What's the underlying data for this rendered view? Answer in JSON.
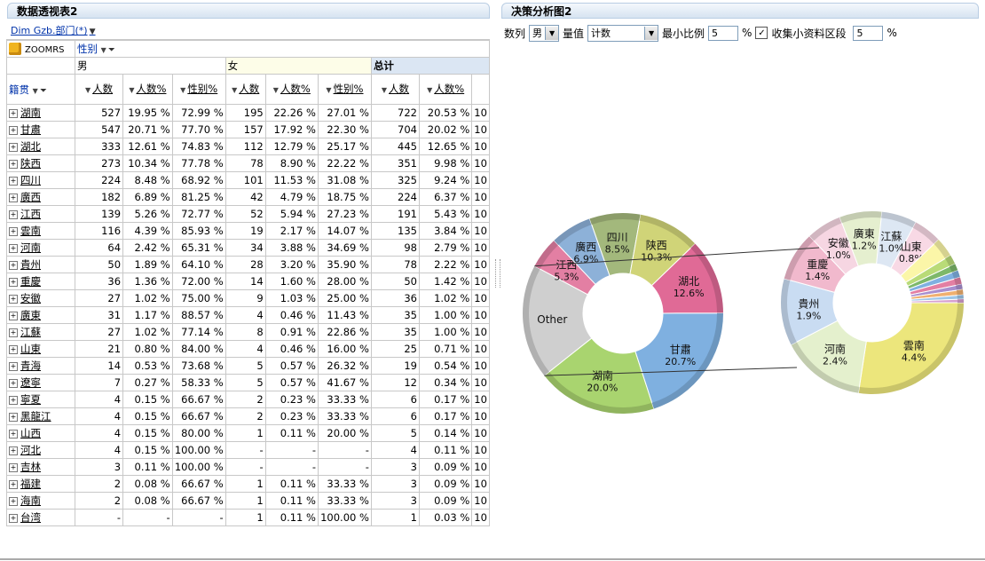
{
  "left_panel": {
    "title": "数据透视表2",
    "dim_link": "Dim Gzb.部门(*)",
    "cube_label": "ZOOMRS",
    "column_field": "性别",
    "row_field": "籍贯",
    "groups": [
      "男",
      "女",
      "总计"
    ],
    "measure_headers": {
      "count": "人数",
      "pct_count": "人数%",
      "pct_sex": "性别%"
    },
    "rows": [
      {
        "name": "湖南",
        "m": [
          "527",
          "19.95 %",
          "72.99 %"
        ],
        "f": [
          "195",
          "22.26 %",
          "27.01 %"
        ],
        "t": [
          "722",
          "20.53 %"
        ],
        "mv": 527,
        "fv": 195,
        "tv": 722
      },
      {
        "name": "甘肅",
        "m": [
          "547",
          "20.71 %",
          "77.70 %"
        ],
        "f": [
          "157",
          "17.92 %",
          "22.30 %"
        ],
        "t": [
          "704",
          "20.02 %"
        ],
        "mv": 547,
        "fv": 157,
        "tv": 704
      },
      {
        "name": "湖北",
        "m": [
          "333",
          "12.61 %",
          "74.83 %"
        ],
        "f": [
          "112",
          "12.79 %",
          "25.17 %"
        ],
        "t": [
          "445",
          "12.65 %"
        ],
        "mv": 333,
        "fv": 112,
        "tv": 445
      },
      {
        "name": "陕西",
        "m": [
          "273",
          "10.34 %",
          "77.78 %"
        ],
        "f": [
          "78",
          "8.90 %",
          "22.22 %"
        ],
        "t": [
          "351",
          "9.98 %"
        ],
        "mv": 273,
        "fv": 78,
        "tv": 351
      },
      {
        "name": "四川",
        "m": [
          "224",
          "8.48 %",
          "68.92 %"
        ],
        "f": [
          "101",
          "11.53 %",
          "31.08 %"
        ],
        "t": [
          "325",
          "9.24 %"
        ],
        "mv": 224,
        "fv": 101,
        "tv": 325
      },
      {
        "name": "廣西",
        "m": [
          "182",
          "6.89 %",
          "81.25 %"
        ],
        "f": [
          "42",
          "4.79 %",
          "18.75 %"
        ],
        "t": [
          "224",
          "6.37 %"
        ],
        "mv": 182,
        "fv": 42,
        "tv": 224
      },
      {
        "name": "江西",
        "m": [
          "139",
          "5.26 %",
          "72.77 %"
        ],
        "f": [
          "52",
          "5.94 %",
          "27.23 %"
        ],
        "t": [
          "191",
          "5.43 %"
        ],
        "mv": 139,
        "fv": 52,
        "tv": 191
      },
      {
        "name": "雲南",
        "m": [
          "116",
          "4.39 %",
          "85.93 %"
        ],
        "f": [
          "19",
          "2.17 %",
          "14.07 %"
        ],
        "t": [
          "135",
          "3.84 %"
        ],
        "mv": 116,
        "fv": 19,
        "tv": 135
      },
      {
        "name": "河南",
        "m": [
          "64",
          "2.42 %",
          "65.31 %"
        ],
        "f": [
          "34",
          "3.88 %",
          "34.69 %"
        ],
        "t": [
          "98",
          "2.79 %"
        ],
        "mv": 64,
        "fv": 34,
        "tv": 98
      },
      {
        "name": "貴州",
        "m": [
          "50",
          "1.89 %",
          "64.10 %"
        ],
        "f": [
          "28",
          "3.20 %",
          "35.90 %"
        ],
        "t": [
          "78",
          "2.22 %"
        ],
        "mv": 50,
        "fv": 28,
        "tv": 78
      },
      {
        "name": "重慶",
        "m": [
          "36",
          "1.36 %",
          "72.00 %"
        ],
        "f": [
          "14",
          "1.60 %",
          "28.00 %"
        ],
        "t": [
          "50",
          "1.42 %"
        ],
        "mv": 36,
        "fv": 14,
        "tv": 50
      },
      {
        "name": "安徽",
        "m": [
          "27",
          "1.02 %",
          "75.00 %"
        ],
        "f": [
          "9",
          "1.03 %",
          "25.00 %"
        ],
        "t": [
          "36",
          "1.02 %"
        ],
        "mv": 27,
        "fv": 9,
        "tv": 36
      },
      {
        "name": "廣東",
        "m": [
          "31",
          "1.17 %",
          "88.57 %"
        ],
        "f": [
          "4",
          "0.46 %",
          "11.43 %"
        ],
        "t": [
          "35",
          "1.00 %"
        ],
        "mv": 31,
        "fv": 4,
        "tv": 35
      },
      {
        "name": "江蘇",
        "m": [
          "27",
          "1.02 %",
          "77.14 %"
        ],
        "f": [
          "8",
          "0.91 %",
          "22.86 %"
        ],
        "t": [
          "35",
          "1.00 %"
        ],
        "mv": 27,
        "fv": 8,
        "tv": 35
      },
      {
        "name": "山東",
        "m": [
          "21",
          "0.80 %",
          "84.00 %"
        ],
        "f": [
          "4",
          "0.46 %",
          "16.00 %"
        ],
        "t": [
          "25",
          "0.71 %"
        ],
        "mv": 21,
        "fv": 4,
        "tv": 25
      },
      {
        "name": "青海",
        "m": [
          "14",
          "0.53 %",
          "73.68 %"
        ],
        "f": [
          "5",
          "0.57 %",
          "26.32 %"
        ],
        "t": [
          "19",
          "0.54 %"
        ],
        "mv": 14,
        "fv": 5,
        "tv": 19
      },
      {
        "name": "遼寧",
        "m": [
          "7",
          "0.27 %",
          "58.33 %"
        ],
        "f": [
          "5",
          "0.57 %",
          "41.67 %"
        ],
        "t": [
          "12",
          "0.34 %"
        ],
        "mv": 7,
        "fv": 5,
        "tv": 12
      },
      {
        "name": "寧夏",
        "m": [
          "4",
          "0.15 %",
          "66.67 %"
        ],
        "f": [
          "2",
          "0.23 %",
          "33.33 %"
        ],
        "t": [
          "6",
          "0.17 %"
        ],
        "mv": 4,
        "fv": 2,
        "tv": 6
      },
      {
        "name": "黑龍江",
        "m": [
          "4",
          "0.15 %",
          "66.67 %"
        ],
        "f": [
          "2",
          "0.23 %",
          "33.33 %"
        ],
        "t": [
          "6",
          "0.17 %"
        ],
        "mv": 4,
        "fv": 2,
        "tv": 6
      },
      {
        "name": "山西",
        "m": [
          "4",
          "0.15 %",
          "80.00 %"
        ],
        "f": [
          "1",
          "0.11 %",
          "20.00 %"
        ],
        "t": [
          "5",
          "0.14 %"
        ],
        "mv": 4,
        "fv": 1,
        "tv": 5
      },
      {
        "name": "河北",
        "m": [
          "4",
          "0.15 %",
          "100.00 %"
        ],
        "f": [
          "-",
          "-",
          "-"
        ],
        "t": [
          "4",
          "0.11 %"
        ],
        "mv": 4,
        "fv": 0,
        "tv": 4
      },
      {
        "name": "吉林",
        "m": [
          "3",
          "0.11 %",
          "100.00 %"
        ],
        "f": [
          "-",
          "-",
          "-"
        ],
        "t": [
          "3",
          "0.09 %"
        ],
        "mv": 3,
        "fv": 0,
        "tv": 3
      },
      {
        "name": "福建",
        "m": [
          "2",
          "0.08 %",
          "66.67 %"
        ],
        "f": [
          "1",
          "0.11 %",
          "33.33 %"
        ],
        "t": [
          "3",
          "0.09 %"
        ],
        "mv": 2,
        "fv": 1,
        "tv": 3
      },
      {
        "name": "海南",
        "m": [
          "2",
          "0.08 %",
          "66.67 %"
        ],
        "f": [
          "1",
          "0.11 %",
          "33.33 %"
        ],
        "t": [
          "3",
          "0.09 %"
        ],
        "mv": 2,
        "fv": 1,
        "tv": 3
      },
      {
        "name": "台湾",
        "m": [
          "-",
          "-",
          "-"
        ],
        "f": [
          "1",
          "0.11 %",
          "100.00 %"
        ],
        "t": [
          "1",
          "0.03 %"
        ],
        "mv": 0,
        "fv": 1,
        "tv": 1
      }
    ],
    "overflow_cell": "10"
  },
  "right_panel": {
    "title": "决策分析图2",
    "controls": {
      "series_label": "数列",
      "series_value": "男",
      "measure_label": "量值",
      "measure_value": "计数",
      "min_ratio_label": "最小比例",
      "min_ratio_value": "5",
      "pct1": "%",
      "collect_label": "收集小资料区段",
      "collect_value": "5",
      "pct2": "%"
    }
  },
  "chart_data": {
    "type": "pie",
    "main": {
      "slices": [
        {
          "label": "湖南",
          "pct": "20.0%",
          "value": 20.0,
          "color": "#a9d46f"
        },
        {
          "label": "Other",
          "pct": "",
          "value": 19.1,
          "color": "#cfcfcf"
        },
        {
          "label": "江西",
          "pct": "5.3%",
          "value": 5.3,
          "color": "#e37fa3"
        },
        {
          "label": "廣西",
          "pct": "6.9%",
          "value": 6.9,
          "color": "#8db1d8"
        },
        {
          "label": "四川",
          "pct": "8.5%",
          "value": 8.5,
          "color": "#a3b87c"
        },
        {
          "label": "陕西",
          "pct": "10.3%",
          "value": 10.3,
          "color": "#d0d478"
        },
        {
          "label": "湖北",
          "pct": "12.6%",
          "value": 12.6,
          "color": "#e06a96"
        },
        {
          "label": "甘肅",
          "pct": "20.7%",
          "value": 20.7,
          "color": "#7fb0e0"
        }
      ]
    },
    "other": {
      "slices": [
        {
          "label": "雲南",
          "pct": "4.4%",
          "value": 4.4,
          "color": "#ece67c"
        },
        {
          "label": "河南",
          "pct": "2.4%",
          "value": 2.4,
          "color": "#e4f0cd"
        },
        {
          "label": "貴州",
          "pct": "1.9%",
          "value": 1.9,
          "color": "#c9dcf2"
        },
        {
          "label": "重慶",
          "pct": "1.4%",
          "value": 1.4,
          "color": "#f1b9cd"
        },
        {
          "label": "安徽",
          "pct": "1.0%",
          "value": 1.0,
          "color": "#f6d6e2"
        },
        {
          "label": "廣東",
          "pct": "1.2%",
          "value": 1.2,
          "color": "#e5efcf"
        },
        {
          "label": "江蘇",
          "pct": "1.0%",
          "value": 1.0,
          "color": "#dde7f3"
        },
        {
          "label": "山東",
          "pct": "0.8%",
          "value": 0.8,
          "color": "#f8d9e5"
        },
        {
          "label": "",
          "pct": "",
          "value": 0.55,
          "color": "#fbf6a8"
        },
        {
          "label": "",
          "pct": "",
          "value": 0.27,
          "color": "#b9db78"
        },
        {
          "label": "",
          "pct": "",
          "value": 0.2,
          "color": "#7db86a"
        },
        {
          "label": "",
          "pct": "",
          "value": 0.2,
          "color": "#7fb0e0"
        },
        {
          "label": "",
          "pct": "",
          "value": 0.2,
          "color": "#e37fa3"
        },
        {
          "label": "",
          "pct": "",
          "value": 0.15,
          "color": "#a88fcf"
        },
        {
          "label": "",
          "pct": "",
          "value": 0.15,
          "color": "#f0b070"
        },
        {
          "label": "",
          "pct": "",
          "value": 0.12,
          "color": "#9ec6e8"
        },
        {
          "label": "",
          "pct": "",
          "value": 0.1,
          "color": "#d6a0d0"
        }
      ]
    }
  }
}
